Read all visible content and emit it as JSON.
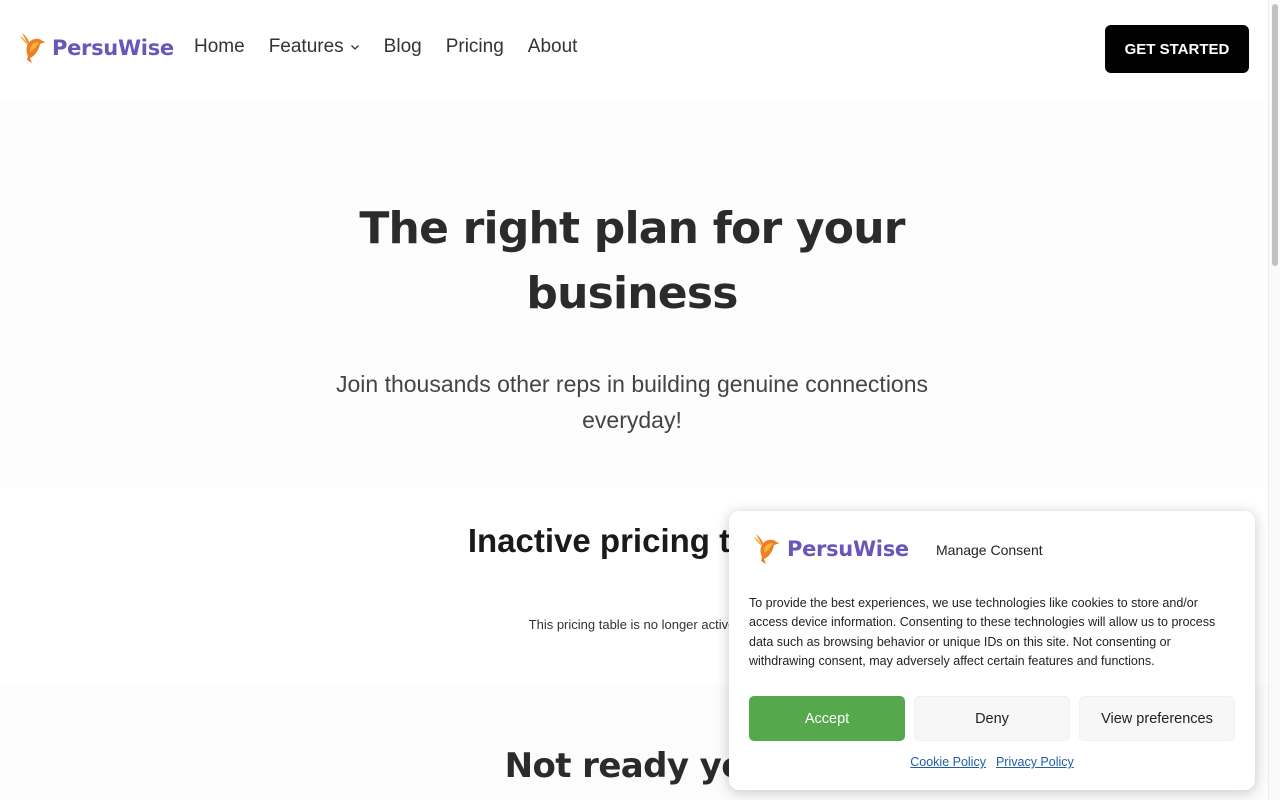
{
  "brand": {
    "name": "PersuWise",
    "color": "#6a55b8",
    "logo_icon": "hummingbird-icon"
  },
  "nav": {
    "items": [
      {
        "label": "Home"
      },
      {
        "label": "Features",
        "has_dropdown": true
      },
      {
        "label": "Blog"
      },
      {
        "label": "Pricing"
      },
      {
        "label": "About"
      }
    ],
    "cta_label": "GET STARTED"
  },
  "hero": {
    "title": "The right plan for your business",
    "subtitle": "Join thousands other reps in building genuine connections everyday!"
  },
  "pricing": {
    "title": "Inactive pricing table",
    "note": "This pricing table is no longer active"
  },
  "not_ready": {
    "title": "Not ready yet"
  },
  "consent": {
    "title": "Manage Consent",
    "body": "To provide the best experiences, we use technologies like cookies to store and/or access device information. Consenting to these technologies will allow us to process data such as browsing behavior or unique IDs on this site. Not consenting or withdrawing consent, may adversely affect certain features and functions.",
    "accept_label": "Accept",
    "deny_label": "Deny",
    "preferences_label": "View preferences",
    "links": [
      {
        "label": "Cookie Policy"
      },
      {
        "label": "Privacy Policy"
      }
    ],
    "accept_color": "#56a84c"
  }
}
